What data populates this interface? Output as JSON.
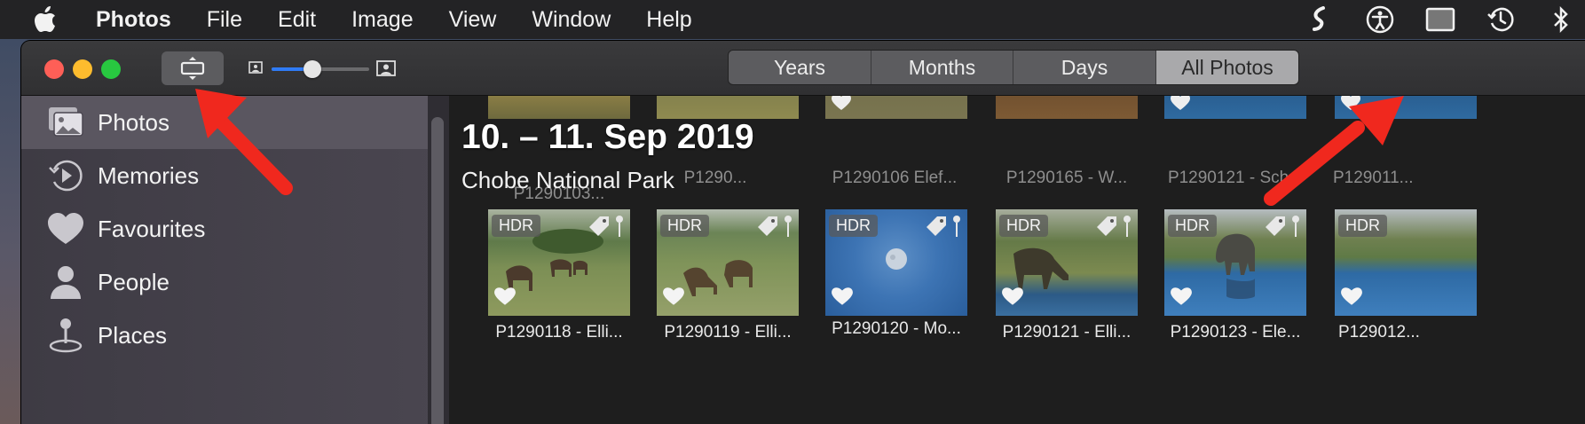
{
  "menubar": {
    "app_name": "Photos",
    "items": [
      "File",
      "Edit",
      "Image",
      "View",
      "Window",
      "Help"
    ],
    "status_icons": [
      "script-icon",
      "accessibility-icon",
      "display-icon",
      "time-machine-icon",
      "bluetooth-icon"
    ]
  },
  "toolbar": {
    "segments": [
      "Years",
      "Months",
      "Days",
      "All Photos"
    ],
    "active_segment": "All Photos",
    "zoom_level": 0.42
  },
  "sidebar": {
    "items": [
      {
        "label": "Photos",
        "icon": "photos-icon",
        "selected": true
      },
      {
        "label": "Memories",
        "icon": "memories-icon",
        "selected": false
      },
      {
        "label": "Favourites",
        "icon": "heart-icon",
        "selected": false
      },
      {
        "label": "People",
        "icon": "person-icon",
        "selected": false
      },
      {
        "label": "Places",
        "icon": "map-pin-icon",
        "selected": false
      }
    ]
  },
  "content": {
    "date_title": "10. – 11. Sep 2019",
    "location": "Chobe National Park",
    "top_row_captions": [
      "P1290103...",
      "P1290...",
      "P1290106 Elef...",
      "P1290165 - W...",
      "P1290121 - Sch...",
      "P129011..."
    ],
    "photos": [
      {
        "caption": "P1290118 - Elli...",
        "hdr": "HDR",
        "scene": "savanna"
      },
      {
        "caption": "P1290119 - Elli...",
        "hdr": "HDR",
        "scene": "savanna"
      },
      {
        "caption": "P1290120 - Mo...",
        "hdr": "HDR",
        "scene": "moon"
      },
      {
        "caption": "P1290121 - Elli...",
        "hdr": "HDR",
        "scene": "water"
      },
      {
        "caption": "P1290123 - Ele...",
        "hdr": "HDR",
        "scene": "elephant"
      },
      {
        "caption": "P129012...",
        "hdr": "HDR",
        "scene": "elephant"
      }
    ]
  },
  "colors": {
    "arrow": "#f0281e",
    "slider_fill": "#2f7bf5",
    "close": "#fe5f57",
    "minimize": "#febc2e",
    "maximize": "#28c840"
  }
}
